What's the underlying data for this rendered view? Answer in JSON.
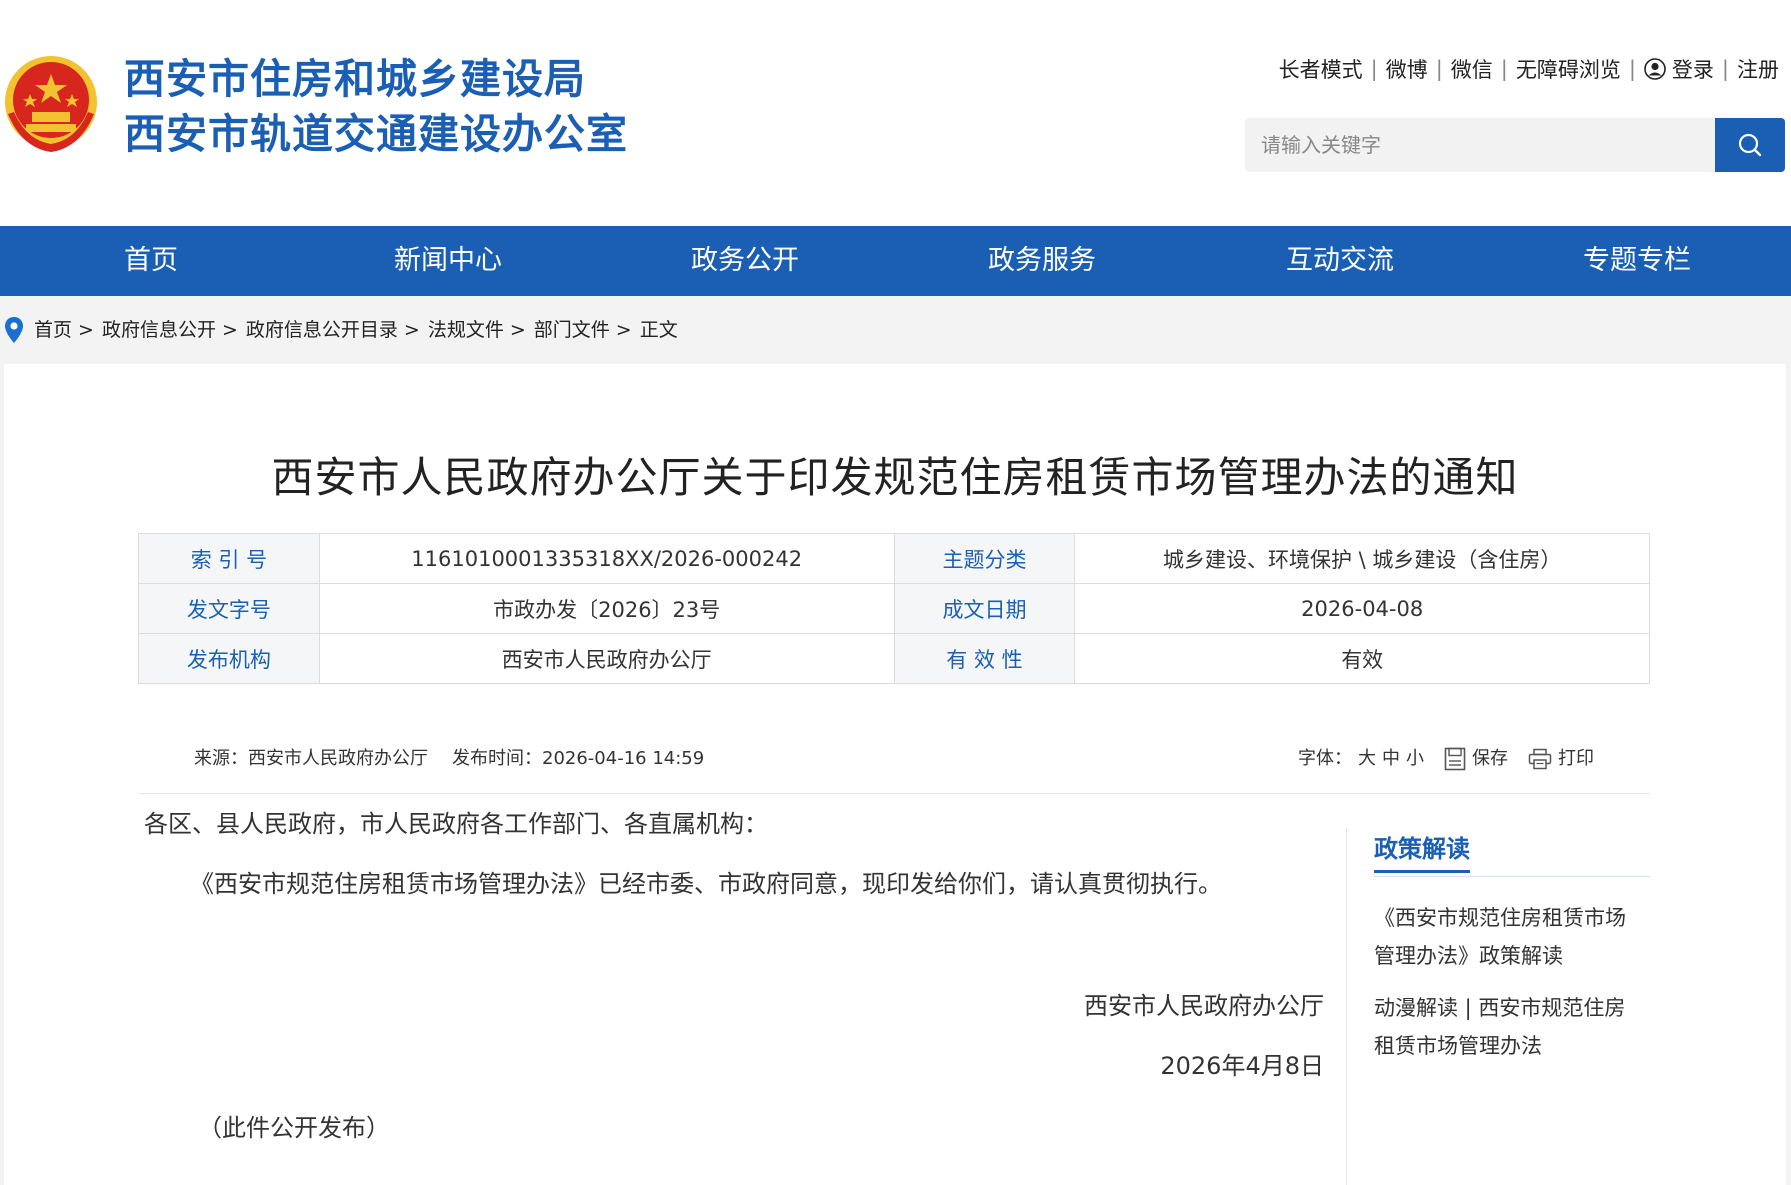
{
  "header": {
    "title_line1": "西安市住房和城乡建设局",
    "title_line2": "西安市轨道交通建设办公室",
    "emblem_icon": "national-emblem-icon",
    "links": [
      "长者模式",
      "微博",
      "微信",
      "无障碍浏览"
    ],
    "login": "登录",
    "register": "注册",
    "search": {
      "placeholder": "请输入关键字",
      "icon": "search-icon"
    }
  },
  "nav": {
    "items": [
      "首页",
      "新闻中心",
      "政务公开",
      "政务服务",
      "互动交流",
      "专题专栏"
    ]
  },
  "breadcrumb": {
    "items": [
      "首页",
      "政府信息公开",
      "政府信息公开目录",
      "法规文件",
      "部门文件",
      "正文"
    ],
    "arrow": ">"
  },
  "document": {
    "title": "西安市人民政府办公厅关于印发规范住房租赁市场管理办法的通知",
    "meta": [
      {
        "label": "索 引 号",
        "value": "11610100013353​18XX/2026-000242",
        "label2": "主题分类",
        "value2": "城乡建设、环境保护 \\ 城乡建设（含住房）"
      },
      {
        "label": "发文字号",
        "value": "市政办发〔2026〕23号",
        "label2": "成文日期",
        "value2": "2026-04-08"
      },
      {
        "label": "发布机构",
        "value": "西安市人民政府办公厅",
        "label2": "有 效 性",
        "value2": "有效"
      }
    ],
    "source_label": "来源：",
    "source": "西安市人民政府办公厅",
    "time_label": "发布时间：",
    "time": "2026-04-16 14:59",
    "font_label": "字体：",
    "font_sizes": [
      "大",
      "中",
      "小"
    ],
    "save": "保存",
    "print": "打印",
    "salutation": "各区、县人民政府，市人民政府各工作部门、各直属机构：",
    "paragraph": "《西安市规范住房租赁市场管理办法》已经市委、市政府同意，现印发给你们，请认真贯彻执行。",
    "sign_org": "西安市人民政府办公厅",
    "sign_date": "2026年4月8日",
    "note": "（此件公开发布）"
  },
  "sidebar": {
    "title": "政策解读",
    "links": [
      {
        "line1": "《西安市规范住房租赁市场",
        "line2": "管理办法》政策解读"
      },
      {
        "line1": "动漫解读 | 西安市规范住房",
        "line2": "租赁市场管理办法"
      }
    ]
  },
  "colors": {
    "brand": "#1a5fb4",
    "emblem_red": "#d7261e",
    "emblem_gold": "#f2c230"
  }
}
